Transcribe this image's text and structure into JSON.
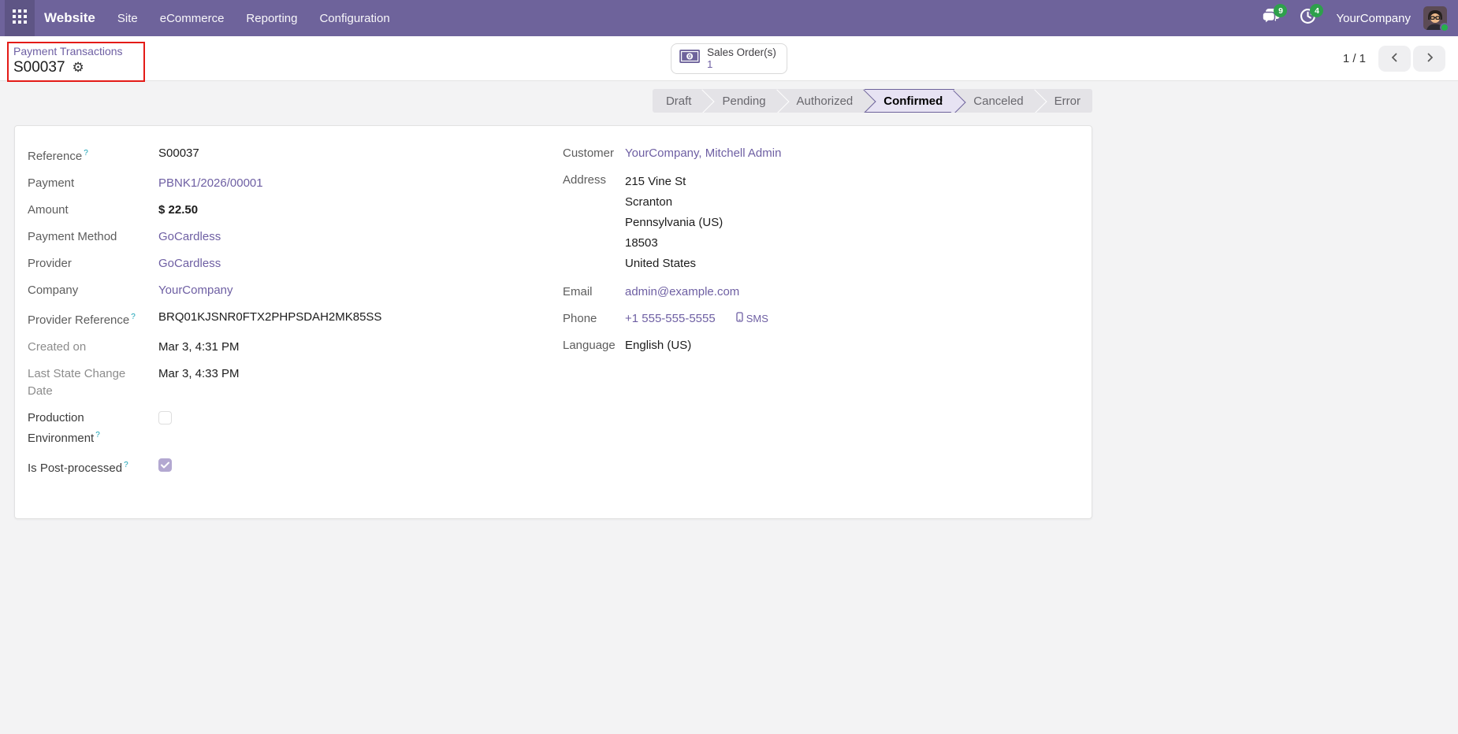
{
  "navbar": {
    "brand": "Website",
    "menus": [
      "Site",
      "eCommerce",
      "Reporting",
      "Configuration"
    ],
    "messages_badge": "9",
    "activities_badge": "4",
    "company": "YourCompany"
  },
  "breadcrumb": {
    "parent": "Payment Transactions",
    "current": "S00037"
  },
  "stat_button": {
    "label": "Sales Order(s)",
    "count": "1"
  },
  "pager": {
    "value": "1 / 1"
  },
  "statusbar": {
    "steps": [
      "Draft",
      "Pending",
      "Authorized",
      "Confirmed",
      "Canceled",
      "Error"
    ],
    "active": "Confirmed"
  },
  "form": {
    "left": [
      {
        "label": "Reference",
        "help": "?",
        "value": "S00037"
      },
      {
        "label": "Payment",
        "value": "PBNK1/2026/00001",
        "link": true
      },
      {
        "label": "Amount",
        "value": "$ 22.50"
      },
      {
        "label": "Payment Method",
        "value": "GoCardless",
        "link": true
      },
      {
        "label": "Provider",
        "value": "GoCardless",
        "link": true
      },
      {
        "label": "Company",
        "value": "YourCompany",
        "link": true
      },
      {
        "label": "Provider Reference",
        "help": "?",
        "value": "BRQ01KJSNR0FTX2PHPSDAH2MK85SS"
      },
      {
        "label": "Created on",
        "value": "Mar 3, 4:31 PM",
        "muted": true
      },
      {
        "label": "Last State Change Date",
        "value": "Mar 3, 4:33 PM",
        "muted": true
      },
      {
        "label": "Production Environment",
        "help": "?",
        "checkbox": "unchecked"
      },
      {
        "label": "Is Post-processed",
        "help": "?",
        "checkbox": "checked"
      }
    ],
    "right": {
      "customer": {
        "label": "Customer",
        "value": "YourCompany, Mitchell Admin"
      },
      "address": {
        "label": "Address",
        "lines": [
          "215 Vine St",
          "Scranton",
          "Pennsylvania (US)",
          "18503",
          "United States"
        ]
      },
      "email": {
        "label": "Email",
        "value": "admin@example.com"
      },
      "phone": {
        "label": "Phone",
        "value": "+1 555-555-5555",
        "sms_label": "SMS"
      },
      "language": {
        "label": "Language",
        "value": "English (US)"
      }
    }
  },
  "icons": {
    "apps": "grid-3x3",
    "messages": "speech-bubbles",
    "activities": "clock",
    "gear": "gear",
    "stat": "money-bill",
    "sms": "mobile-phone",
    "prev": "chevron-left",
    "next": "chevron-right"
  },
  "colors": {
    "navbar": "#6e639b",
    "link": "#6e5fa3",
    "badge_green": "#2ea04c",
    "annotation_red": "#e41b17",
    "step_active_bg": "#e7e3f3",
    "step_active_border": "#6e639b",
    "help_teal": "#14a0b4",
    "checkbox_checked": "#b3a8d1"
  }
}
